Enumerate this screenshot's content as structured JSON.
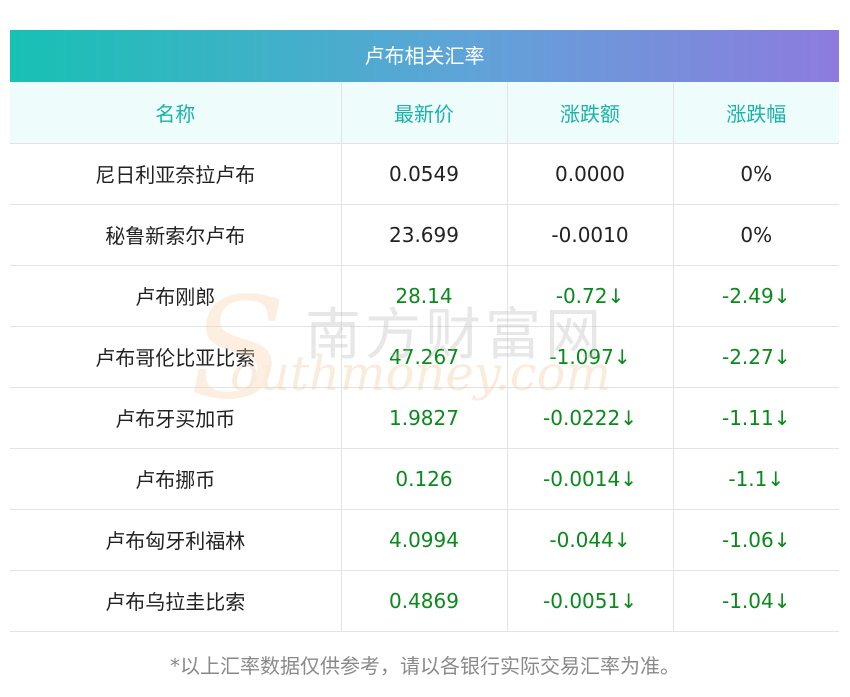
{
  "table": {
    "title": "卢布相关汇率",
    "headers": [
      "名称",
      "最新价",
      "涨跌额",
      "涨跌幅"
    ],
    "rows": [
      {
        "name": "尼日利亚奈拉卢布",
        "price": "0.0549",
        "change": "0.0000",
        "pct": "0%",
        "trend": "flat"
      },
      {
        "name": "秘鲁新索尔卢布",
        "price": "23.699",
        "change": "-0.0010",
        "pct": "0%",
        "trend": "flat"
      },
      {
        "name": "卢布刚郎",
        "price": "28.14",
        "change": "-0.72↓",
        "pct": "-2.49↓",
        "trend": "down"
      },
      {
        "name": "卢布哥伦比亚比索",
        "price": "47.267",
        "change": "-1.097↓",
        "pct": "-2.27↓",
        "trend": "down"
      },
      {
        "name": "卢布牙买加币",
        "price": "1.9827",
        "change": "-0.0222↓",
        "pct": "-1.11↓",
        "trend": "down"
      },
      {
        "name": "卢布挪币",
        "price": "0.126",
        "change": "-0.0014↓",
        "pct": "-1.1↓",
        "trend": "down"
      },
      {
        "name": "卢布匈牙利福林",
        "price": "4.0994",
        "change": "-0.044↓",
        "pct": "-1.06↓",
        "trend": "down"
      },
      {
        "name": "卢布乌拉圭比索",
        "price": "0.4869",
        "change": "-0.0051↓",
        "pct": "-1.04↓",
        "trend": "down"
      }
    ]
  },
  "watermark": {
    "cn": "南方财富网",
    "en": "outhmoney.com",
    "letter": "S"
  },
  "footnote": "*以上汇率数据仅供参考，请以各银行实际交易汇率为准。",
  "colors": {
    "header_text": "#1ab3a7",
    "down": "#0a8a1c",
    "gradient_start": "#17c1b3",
    "gradient_end": "#8d7bde"
  }
}
